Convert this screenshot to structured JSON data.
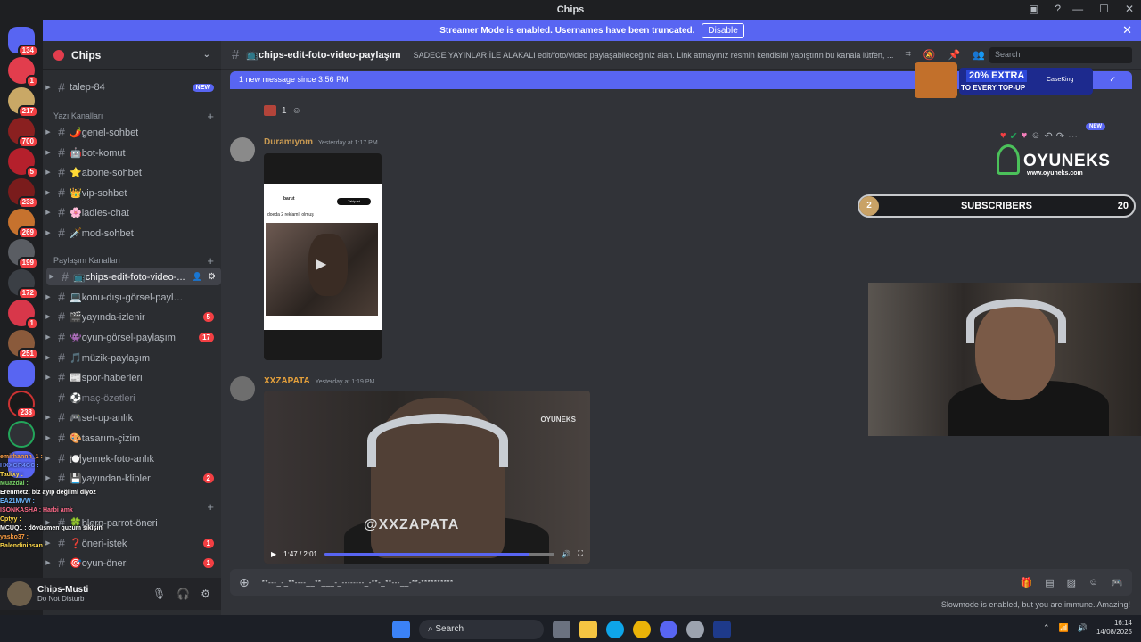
{
  "window": {
    "title": "Chips"
  },
  "banner": {
    "text": "Streamer Mode is enabled. Usernames have been truncated.",
    "disable_label": "Disable"
  },
  "server": {
    "name": "Chips"
  },
  "guild_badges": [
    "134",
    "1",
    "217",
    "700",
    "5",
    "233",
    "269",
    "199",
    "172",
    "1",
    "251",
    "238"
  ],
  "channels_top": [
    {
      "name": "talep-84",
      "tag": "NEW"
    }
  ],
  "category_text": "Yazı Kanalları",
  "text_channels": [
    {
      "name": "🌶️genel-sohbet"
    },
    {
      "name": "🤖bot-komut"
    },
    {
      "name": "⭐abone-sohbet"
    },
    {
      "name": "👑vip-sohbet"
    },
    {
      "name": "🌸ladies-chat"
    },
    {
      "name": "🗡️mod-sohbet"
    }
  ],
  "category_share": "Paylaşım Kanalları",
  "share_channels": [
    {
      "name": "📺chips-edit-foto-video-...",
      "count": "",
      "active": true
    },
    {
      "name": "💻konu-dışı-görsel-paylaşım",
      "count": ""
    },
    {
      "name": "🎬yayında-izlenir",
      "count": "5"
    },
    {
      "name": "👾oyun-görsel-paylaşım",
      "count": "17"
    },
    {
      "name": "🎵müzik-paylaşım",
      "count": ""
    },
    {
      "name": "📰spor-haberleri",
      "count": ""
    },
    {
      "name": "⚽maç-özetleri",
      "count": "",
      "muted": true
    },
    {
      "name": "🎮set-up-anlık",
      "count": ""
    },
    {
      "name": "🎨tasarım-çizim",
      "count": ""
    },
    {
      "name": "🍽️yemek-foto-anlık",
      "count": ""
    },
    {
      "name": "💾yayından-klipler",
      "count": "2"
    }
  ],
  "extra_channels": [
    {
      "name": "🍀blerp-parrot-öneri",
      "count": ""
    },
    {
      "name": "❓öneri-istek",
      "count": "1"
    },
    {
      "name": "🎯oyun-öneri",
      "count": "1"
    }
  ],
  "chat_overlay": [
    "emirhannn_1 :",
    "HXXGR4GC :",
    "Tadixy :",
    "Muazdal :",
    "Erenmetz: biz ayıp değilmi diyoz",
    "EA21MVW :",
    "ISONKASHA : Harbi amk",
    "Cptyy :",
    "MCUQ1 : dövüşmen quzum sikişin",
    "yasko37 :",
    "Balendinihsan :"
  ],
  "user": {
    "name": "Chips-Musti",
    "status": "Do Not Disturb"
  },
  "channel_header": {
    "name": "📺chips-edit-foto-video-paylaşım",
    "topic": "SADECE YAYINLAR İLE ALAKALI edit/foto/video paylaşabileceğiniz alan. Link atmayınız resmin kendisini yapıştırın bu kanala lütfen, ...",
    "search_placeholder": "Search"
  },
  "new_messages": {
    "text": "1 new message since 3:56 PM",
    "mark_label": "Mark As Read"
  },
  "reaction_count": "1",
  "messages": [
    {
      "author": "Duramıyom",
      "author_color": "#c99a52",
      "timestamp": "Yesterday at 1:17 PM",
      "embed_user": "barut",
      "embed_follow": "Takip et",
      "embed_caption": "doeda 2 reklamlı olmuş"
    },
    {
      "author": "XXZAPATA",
      "author_color": "#e6a13b",
      "timestamp": "Yesterday at 1:19 PM",
      "video_watermark": "@XXZAPATA",
      "video_logo": "OYUNEKS",
      "video_time": "1:47 / 2:01",
      "video_progress": 0.89
    }
  ],
  "composer": {
    "value": "**---_-_**----__**___-_--------_-**-_**---__-**-**********"
  },
  "slowmode": "Slowmode is enabled, but you are immune. Amazing!",
  "overlay_ad": {
    "percent": "20% EXTRA",
    "sub": "TO EVERY TOP-UP",
    "brand": "CaseKing"
  },
  "oyuneks": {
    "name": "OYUNEKS",
    "url": "www.oyuneks.com",
    "new_tag": "NEW"
  },
  "subscribers": {
    "current": "2",
    "label": "SUBSCRIBERS",
    "goal": "20"
  },
  "taskbar": {
    "search": "Search",
    "time": "16:14",
    "date": "14/08/2025"
  }
}
